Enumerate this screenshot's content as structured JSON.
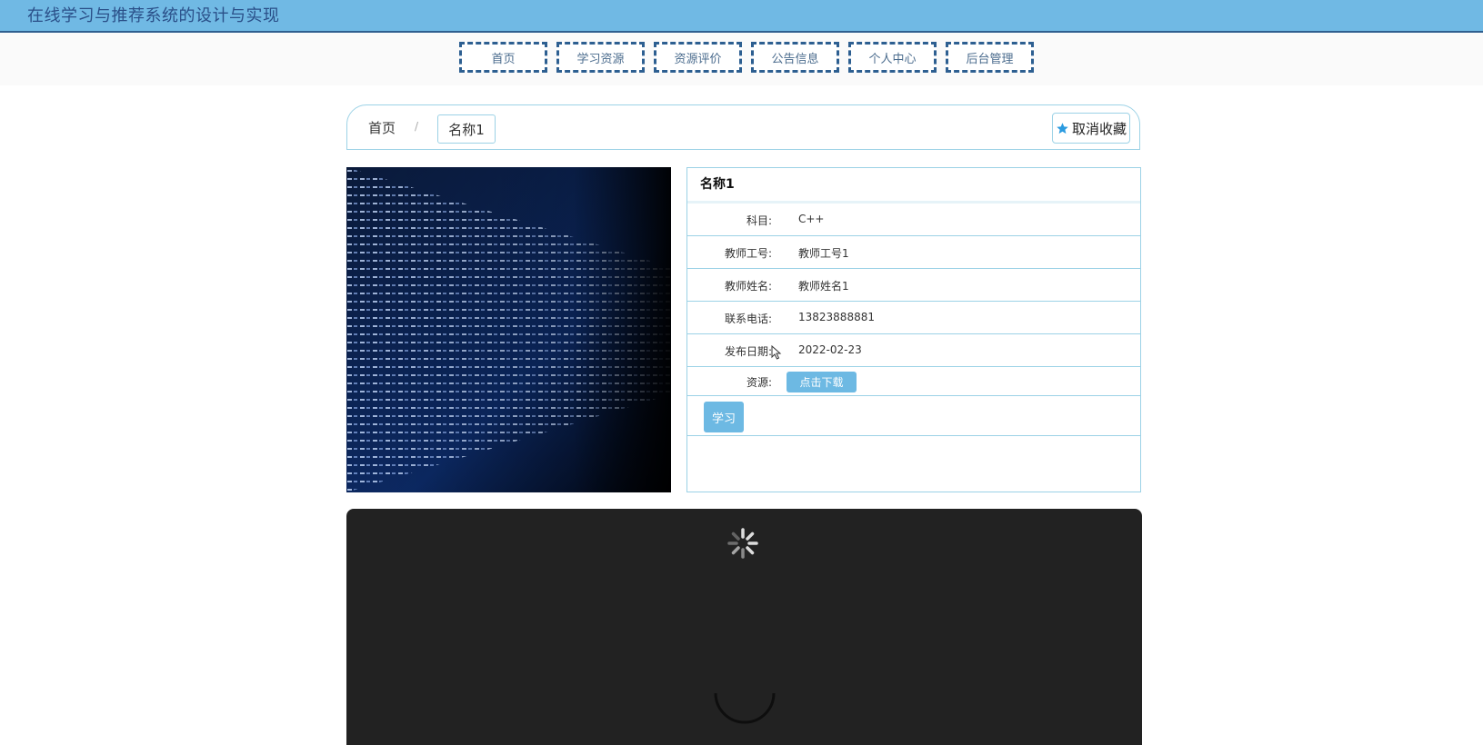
{
  "header": {
    "title": "在线学习与推荐系统的设计与实现"
  },
  "nav": [
    {
      "label": "首页"
    },
    {
      "label": "学习资源"
    },
    {
      "label": "资源评价"
    },
    {
      "label": "公告信息"
    },
    {
      "label": "个人中心"
    },
    {
      "label": "后台管理"
    }
  ],
  "breadcrumb": {
    "home": "首页",
    "separator": "/",
    "current": "名称1"
  },
  "favorite": {
    "label": "取消收藏",
    "icon": "star-icon"
  },
  "detail": {
    "title": "名称1",
    "rows": [
      {
        "label": "科目:",
        "value": "C++"
      },
      {
        "label": "教师工号:",
        "value": "教师工号1"
      },
      {
        "label": "教师姓名:",
        "value": "教师姓名1"
      },
      {
        "label": "联系电话:",
        "value": "13823888881"
      },
      {
        "label": "发布日期:",
        "value": "2022-02-23"
      }
    ],
    "resource": {
      "label": "资源:",
      "button": "点击下载"
    },
    "study_button": "学习"
  },
  "colors": {
    "header_bg": "#70b9e4",
    "nav_border": "#2d5f91",
    "accent": "#6db9e3",
    "card_border": "#9cd2e6",
    "video_bg": "#222222"
  }
}
